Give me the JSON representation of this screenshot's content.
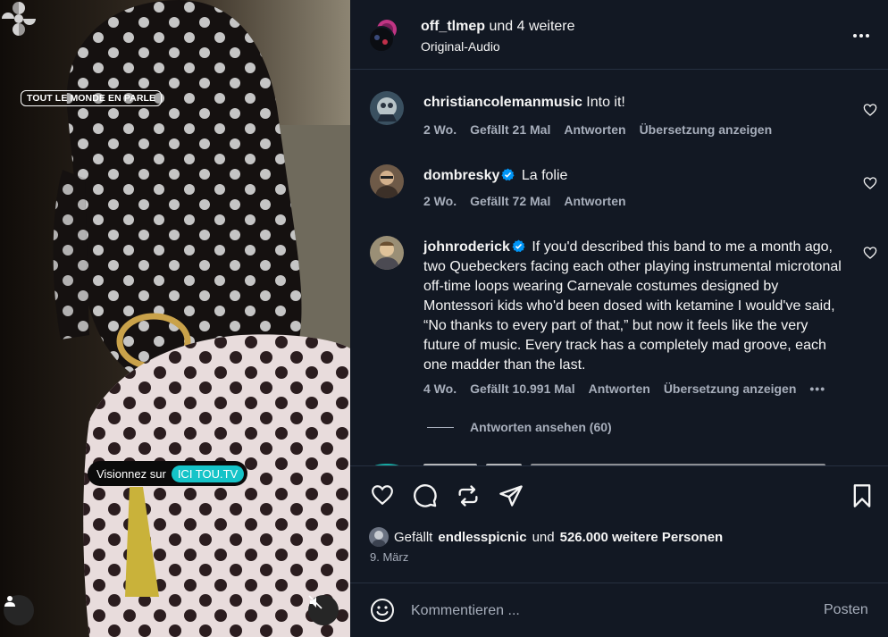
{
  "media": {
    "show_tag": "TOUT LE MONDE EN PARLE",
    "watch_pill": {
      "prefix": "Visionnez sur",
      "platform": "ICI TOU.TV"
    }
  },
  "header": {
    "username": "off_tlmep",
    "others": "und 4 weitere",
    "audio": "Original-Audio"
  },
  "comments": [
    {
      "user": "christiancolemanmusic",
      "verified": false,
      "text": "Into it!",
      "meta": {
        "time": "2 Wo.",
        "likes": "Gefällt 21 Mal",
        "reply": "Antworten",
        "translate": "Übersetzung anzeigen"
      }
    },
    {
      "user": "dombresky",
      "verified": true,
      "text": "La folie",
      "meta": {
        "time": "2 Wo.",
        "likes": "Gefällt 72 Mal",
        "reply": "Antworten"
      }
    },
    {
      "user": "johnroderick",
      "verified": true,
      "text": "If you'd described this band to me a month ago, two Quebeckers facing each other playing instrumental microtonal off-time loops wearing Carnevale costumes designed by Montessori kids who'd been dosed with ketamine I would've said, “No thanks to every part of that,” but now it feels like the very future of music. Every track has a completely mad groove, each one madder than the last.",
      "meta": {
        "time": "4 Wo.",
        "likes": "Gefällt 10.991 Mal",
        "reply": "Antworten",
        "translate": "Übersetzung anzeigen"
      }
    }
  ],
  "view_replies": "Antworten ansehen (60)",
  "likes": {
    "prefix": "Gefällt",
    "user": "endlesspicnic",
    "middle": "und",
    "count": "526.000 weitere Personen"
  },
  "date": "9. März",
  "comment_box": {
    "placeholder": "Kommentieren ...",
    "post_label": "Posten"
  },
  "colors": {
    "background": "#121823",
    "muted": "#a7aebb",
    "verified": "#0095f6",
    "pill_accent": "#15c4c8"
  }
}
